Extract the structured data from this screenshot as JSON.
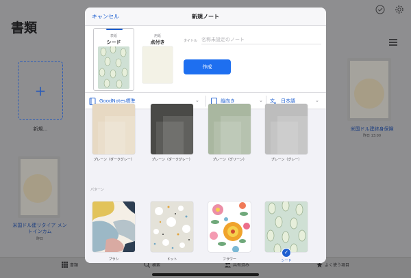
{
  "background": {
    "title": "書類",
    "new_label": "新規...",
    "docs": [
      {
        "caption": "米国ドル建終身保険",
        "date": "昨日 13:00"
      },
      {
        "caption": "米国ドル建リタイア メントインカム",
        "date": "昨日"
      }
    ],
    "tabs": [
      {
        "label": "書類",
        "icon": "grid-icon"
      },
      {
        "label": "検索",
        "icon": "search-icon"
      },
      {
        "label": "共有済み",
        "icon": "people-icon"
      },
      {
        "label": "よく使う項目",
        "icon": "star-icon"
      }
    ]
  },
  "modal": {
    "cancel": "キャンセル",
    "title": "新規ノート",
    "cover": {
      "sub": "表紙",
      "main": "シード"
    },
    "paper": {
      "sub": "用紙",
      "main": "点付き"
    },
    "title_label": "タイトル",
    "title_placeholder": "名称未設定のノート",
    "create": "作成",
    "options": {
      "template_set": "GoodNotes標準",
      "orientation": "縦向き",
      "language": "日本語"
    },
    "plain_templates": [
      {
        "label": "プレーン（ダークグレー）",
        "color": "#e7d9c3"
      },
      {
        "label": "プレーン（ダークグレー）",
        "color": "#4a4a47"
      },
      {
        "label": "プレーン（グリーン）",
        "color": "#a9b7a0"
      },
      {
        "label": "プレーン（グレー）",
        "color": "#bdbdbd"
      }
    ],
    "section_label": "パターン",
    "pattern_templates": [
      {
        "label": "ブラシ"
      },
      {
        "label": "ドット"
      },
      {
        "label": "フラワー"
      },
      {
        "label": "シード",
        "selected": true
      }
    ],
    "accent_color": "#1e6ff0"
  }
}
